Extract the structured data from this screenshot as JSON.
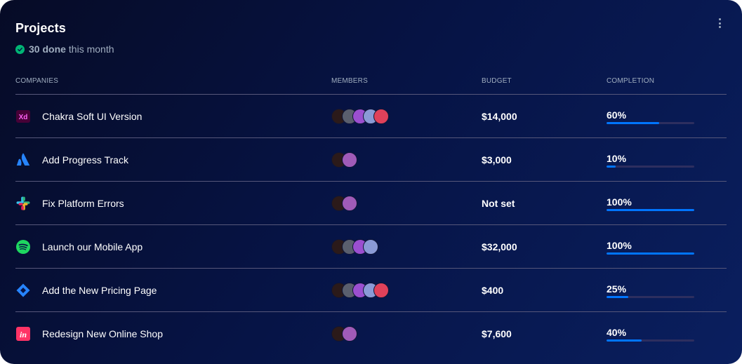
{
  "header": {
    "title": "Projects",
    "done_count": "30 done",
    "done_suffix": "this month"
  },
  "columns": {
    "companies": "COMPANIES",
    "members": "MEMBERS",
    "budget": "BUDGET",
    "completion": "COMPLETION"
  },
  "colors": {
    "accent": "#0075ff",
    "success": "#01b574",
    "divider": "#56577a"
  },
  "projects": [
    {
      "name": "Chakra Soft UI Version",
      "logo_icon": "adobe-xd-icon",
      "member_count": 5,
      "budget": "$14,000",
      "completion_label": "60%",
      "completion": 60
    },
    {
      "name": "Add Progress Track",
      "logo_icon": "atlassian-icon",
      "member_count": 2,
      "budget": "$3,000",
      "completion_label": "10%",
      "completion": 10
    },
    {
      "name": "Fix Platform Errors",
      "logo_icon": "slack-icon",
      "member_count": 2,
      "budget": "Not set",
      "completion_label": "100%",
      "completion": 100
    },
    {
      "name": "Launch our Mobile App",
      "logo_icon": "spotify-icon",
      "member_count": 4,
      "budget": "$32,000",
      "completion_label": "100%",
      "completion": 100
    },
    {
      "name": "Add the New Pricing Page",
      "logo_icon": "jira-icon",
      "member_count": 5,
      "budget": "$400",
      "completion_label": "25%",
      "completion": 25
    },
    {
      "name": "Redesign New Online Shop",
      "logo_icon": "invision-icon",
      "member_count": 2,
      "budget": "$7,600",
      "completion_label": "40%",
      "completion": 40
    }
  ]
}
